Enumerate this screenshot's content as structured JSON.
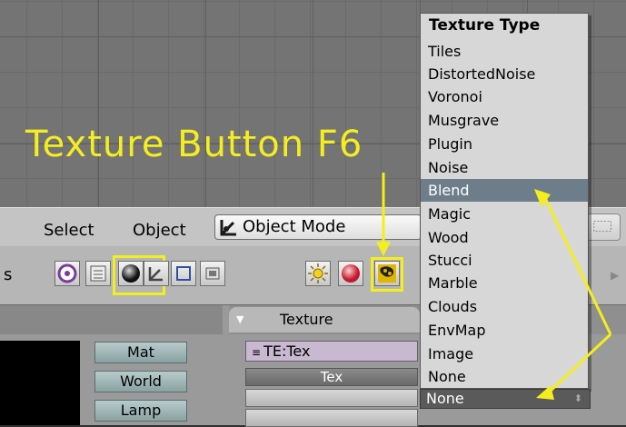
{
  "header": {
    "menus": [
      "Select",
      "Object"
    ],
    "mode_select": "Object Mode"
  },
  "toolbar": {
    "left_letter": "s"
  },
  "panel": {
    "side_buttons": [
      "Mat",
      "World",
      "Lamp"
    ],
    "texture_tab": "Texture",
    "texture_name": "TE:Tex",
    "texture_label": "Tex",
    "type_value": "None"
  },
  "dropdown": {
    "title": "Texture Type",
    "items": [
      "Tiles",
      "DistortedNoise",
      "Voronoi",
      "Musgrave",
      "Plugin",
      "Noise",
      "Blend",
      "Magic",
      "Wood",
      "Stucci",
      "Marble",
      "Clouds",
      "EnvMap",
      "Image",
      "None"
    ],
    "selected": "Blend"
  },
  "annotation": {
    "label": "Texture Button F6",
    "color": "#f4ee1e"
  },
  "icons": [
    "object-mode-icon",
    "grid-icon",
    "world-icon",
    "edit-icon",
    "material-sphere-icon",
    "object-icon",
    "mesh-icon",
    "scene-icon",
    "lamp-icon",
    "material-icon",
    "texture-icon"
  ]
}
